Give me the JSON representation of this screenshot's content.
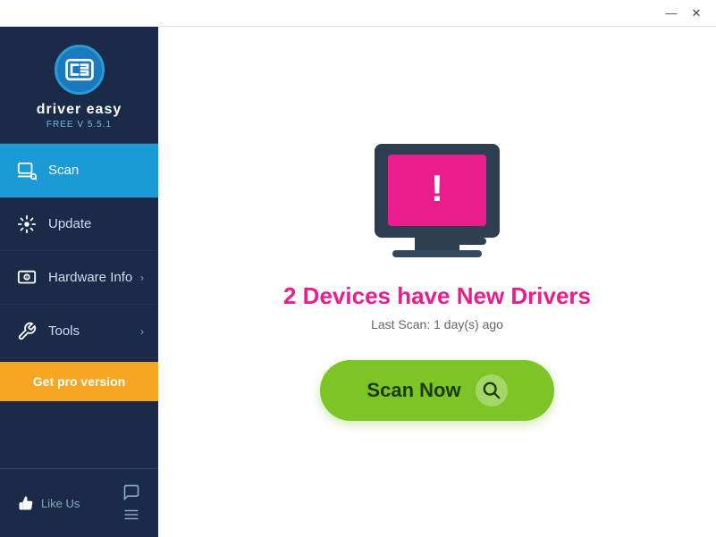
{
  "titlebar": {
    "minimize_label": "—",
    "close_label": "✕"
  },
  "sidebar": {
    "logo_text": "driver easy",
    "logo_version": "FREE V 5.5.1",
    "nav": [
      {
        "id": "scan",
        "label": "Scan",
        "active": true,
        "has_arrow": false
      },
      {
        "id": "update",
        "label": "Update",
        "active": false,
        "has_arrow": false
      },
      {
        "id": "hardware-info",
        "label": "Hardware Info",
        "active": false,
        "has_arrow": true
      },
      {
        "id": "tools",
        "label": "Tools",
        "active": false,
        "has_arrow": true
      }
    ],
    "pro_button_label": "Get pro version",
    "like_us_label": "Like Us"
  },
  "content": {
    "exclamation": "!",
    "headline": "2 Devices have New Drivers",
    "sub_text": "Last Scan: 1 day(s) ago",
    "scan_button_label": "Scan Now"
  }
}
